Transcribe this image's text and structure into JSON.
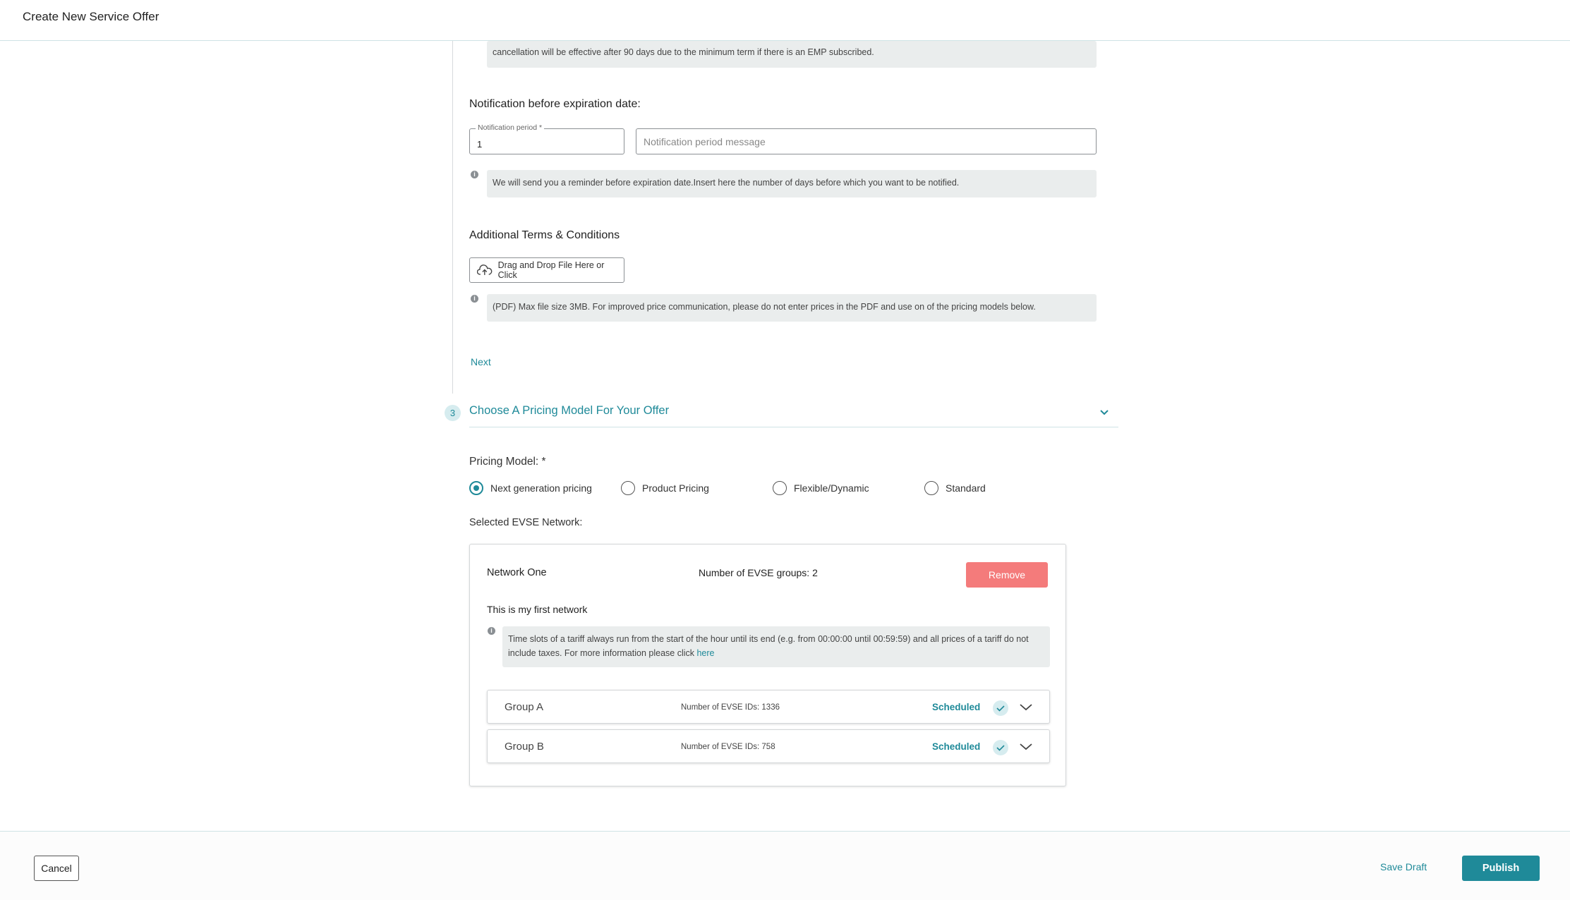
{
  "window": {
    "title": "Create New Service Offer"
  },
  "cancellation_note": "cancellation will be effective after 90 days due to the minimum term if there is an EMP subscribed.",
  "notification": {
    "heading": "Notification before expiration date:",
    "period_label": "Notification period *",
    "period_value": "1",
    "message_placeholder": "Notification period message",
    "info": "We will send you a reminder before expiration date.Insert here the number of days before which you want to be notified."
  },
  "terms": {
    "heading": "Additional Terms & Conditions",
    "upload_label": "Drag and Drop File Here or Click",
    "info": "(PDF) Max file size 3MB. For improved price communication, please do not enter prices in the PDF and use on of the pricing models below."
  },
  "next_label": "Next",
  "step3": {
    "number": "3",
    "title": "Choose A Pricing Model For Your Offer"
  },
  "pricing": {
    "label": "Pricing Model: *",
    "options": [
      {
        "label": "Next generation pricing",
        "selected": true
      },
      {
        "label": "Product Pricing",
        "selected": false
      },
      {
        "label": "Flexible/Dynamic",
        "selected": false
      },
      {
        "label": "Standard",
        "selected": false
      }
    ]
  },
  "evse": {
    "label": "Selected EVSE Network:",
    "network_name": "Network One",
    "group_count": "Number of EVSE groups: 2",
    "remove_label": "Remove",
    "description": "This is my first network",
    "info_text": "Time slots of a tariff always run from the start of the hour until its end (e.g. from 00:00:00 until 00:59:59) and all prices of a tariff do not include taxes. For more information please click ",
    "info_link": "here",
    "groups": [
      {
        "name": "Group A",
        "count": "Number of EVSE IDs: 1336",
        "status": "Scheduled"
      },
      {
        "name": "Group B",
        "count": "Number of EVSE IDs: 758",
        "status": "Scheduled"
      }
    ]
  },
  "footer": {
    "cancel_label": "Cancel",
    "save_draft_label": "Save Draft",
    "publish_label": "Publish"
  },
  "colors": {
    "accent": "#1f8a99",
    "danger": "#f47b7b",
    "info_bg": "#eaeded"
  },
  "icons": {
    "info": "info-icon",
    "upload": "cloud-upload-icon",
    "check": "check-icon",
    "chevron": "chevron-down-icon"
  }
}
